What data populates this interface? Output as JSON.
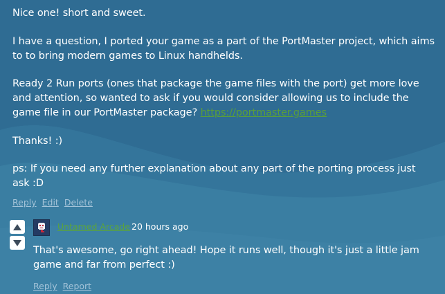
{
  "comment_main": {
    "line1": "Nice one! short and sweet.",
    "para2": " I have a question, I ported your game as a part of the PortMaster project, which aims to to bring modern games to Linux handhelds.",
    "para3_text": "Ready 2 Run ports (ones that package the game files with the port) get more love and attention, so wanted to ask if you would consider allowing us to include the game file in our PortMaster package? ",
    "para3_link": "https://portmaster.games",
    "para4": "Thanks! :)",
    "para5": "ps: If you need any further explanation about any part of the porting process just ask :D",
    "actions": {
      "reply": "Reply",
      "edit": "Edit",
      "delete": "Delete"
    }
  },
  "reply_comment": {
    "username": "Untamed Arcade",
    "timestamp": "20 hours ago",
    "body": "That's awesome, go right ahead! Hope it runs well, though it's just a little jam game and far from perfect :)",
    "actions": {
      "reply": "Reply",
      "report": "Report"
    }
  },
  "colors": {
    "link": "#5a9e3a",
    "username": "#5aa33c",
    "action_link": "#a3c3d8"
  },
  "icons": {
    "upvote": "triangle-up-icon",
    "downvote": "triangle-down-icon",
    "avatar": "pixel-mask-avatar"
  }
}
